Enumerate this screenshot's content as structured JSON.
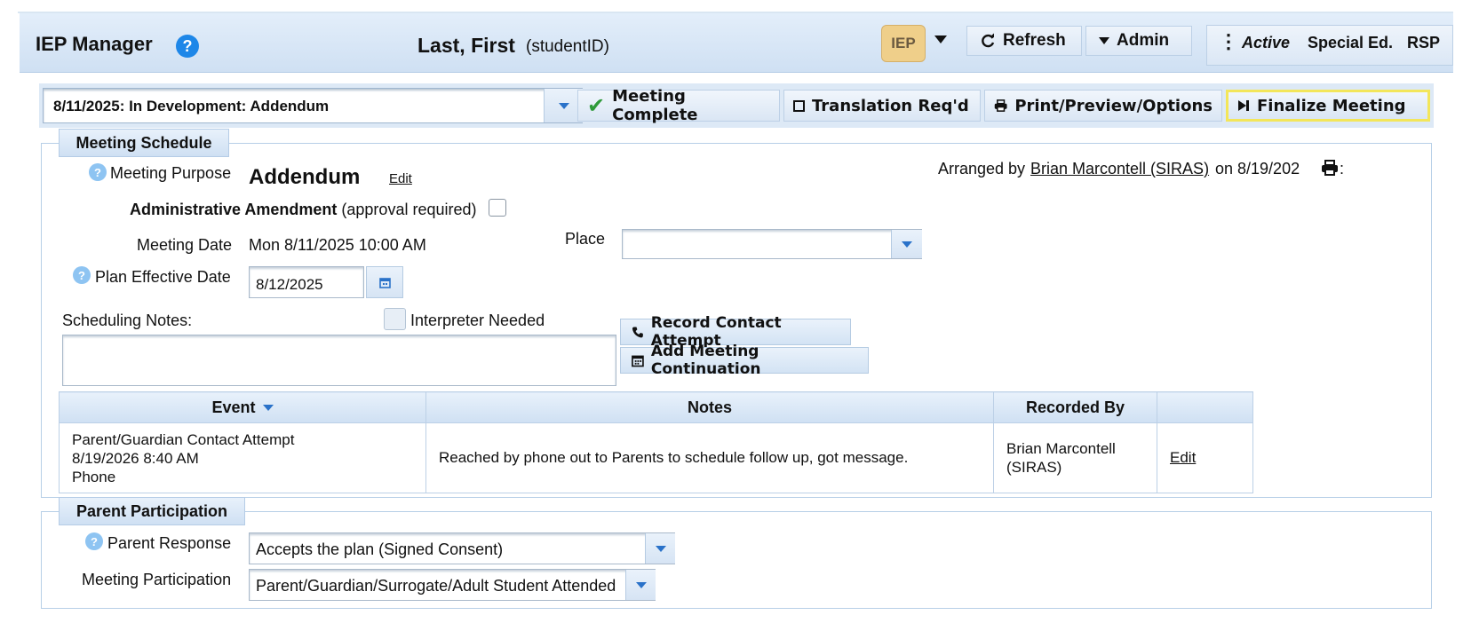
{
  "header": {
    "title": "IEP Manager",
    "help": "?",
    "student_name": "Last, First",
    "student_id": "(studentID)",
    "iep_badge": "IEP",
    "refresh_label": "Refresh",
    "admin_label": "Admin",
    "status_active": "Active",
    "status_program": "Special Ed.",
    "status_service": "RSP"
  },
  "toolbar": {
    "meeting_select": "8/11/2025: In Development: Addendum",
    "meeting_complete": "Meeting Complete",
    "translation": "Translation Req'd",
    "print": "Print/Preview/Options",
    "finalize": "Finalize Meeting"
  },
  "meeting_schedule": {
    "tab": "Meeting Schedule",
    "purpose_label": "Meeting Purpose",
    "purpose_value": "Addendum",
    "edit_link": "Edit",
    "arranged_prefix": "Arranged by",
    "arranged_by": "Brian Marcontell (SIRAS)",
    "arranged_on": "on 8/19/202",
    "admin_amend_bold": "Administrative Amendment",
    "admin_amend_note": "(approval required)",
    "meeting_date_label": "Meeting Date",
    "meeting_date_value": "Mon 8/11/2025 10:00 AM",
    "place_label": "Place",
    "place_value": "",
    "plan_effective_label": "Plan Effective Date",
    "plan_effective_value": "8/12/2025",
    "scheduling_notes_label": "Scheduling Notes:",
    "interpreter_label": "Interpreter Needed",
    "record_contact": "Record Contact Attempt",
    "add_continuation": "Add Meeting Continuation"
  },
  "events_table": {
    "columns": [
      "Event",
      "Notes",
      "Recorded By",
      ""
    ],
    "rows": [
      {
        "event_line1": "Parent/Guardian Contact Attempt",
        "event_line2": "8/19/2026 8:40 AM",
        "event_line3": "Phone",
        "notes": "Reached by phone out to Parents to schedule follow up, got message.",
        "recorded_line1": "Brian Marcontell",
        "recorded_line2": "(SIRAS)",
        "action": "Edit"
      }
    ]
  },
  "parent_participation": {
    "tab": "Parent Participation",
    "response_label": "Parent Response",
    "response_value": "Accepts the plan (Signed Consent)",
    "participation_label": "Meeting Participation",
    "participation_value": "Parent/Guardian/Surrogate/Adult Student Attended"
  }
}
